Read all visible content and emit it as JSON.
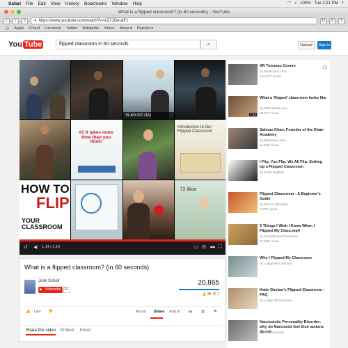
{
  "menubar": {
    "app": "Safari",
    "items": [
      "File",
      "Edit",
      "View",
      "History",
      "Bookmarks",
      "Window",
      "Help"
    ],
    "clock": "Tue 2:21 PM",
    "battery": "100%"
  },
  "window": {
    "title": "What is a flipped classroom? (in 60 seconds) - YouTube"
  },
  "toolbar": {
    "url": "https://www.youtube.com/watch?v=x2j7JGeukFc"
  },
  "bookmarks": [
    "Apple",
    "iCloud",
    "Facebook",
    "Twitter",
    "Wikipedia",
    "Yahoo",
    "News ▾",
    "Popular ▾"
  ],
  "youtube": {
    "logo_you": "You",
    "logo_tube": "Tube",
    "search_value": "flipped classroom in 60 seconds",
    "upload_label": "Upload",
    "signin_label": "Sign in"
  },
  "player": {
    "playlist_label": "PLAYLIST (16)",
    "time": "1:14 / 1:14",
    "progress": 1.0,
    "tiles": {
      "t6": "#1 It takes more time than you think!",
      "t8": "Introduction to Our Flipped Classroom",
      "t9a": "HOW TO",
      "t9b": "FLIP",
      "t9c": "YOUR CLASSROOM",
      "t12": "72 illion"
    }
  },
  "video": {
    "title": "What is a flipped classroom? (in 60 seconds)",
    "channel": "Julie Schell",
    "subscribe_label": "Subscribe",
    "sub_count": "23",
    "views": "20,865",
    "likes": "28",
    "dislikes": "1",
    "like_label": "Like",
    "actions": [
      "About",
      "Share",
      "Add to"
    ],
    "tabs": [
      "Share this video",
      "Embed",
      "Email"
    ]
  },
  "sidebar": [
    {
      "title": "XR Tonneau Covers",
      "channel": "by RealTruck.com",
      "views": "121,227 views",
      "duration": "",
      "colors": [
        "#5b5b5b",
        "#999999"
      ]
    },
    {
      "title": "What a 'flipped' classroom looks like",
      "channel": "by PBS NewsHour",
      "views": "29,271 views",
      "duration": "7:42",
      "colors": [
        "#6b4e3a",
        "#c9a47a"
      ]
    },
    {
      "title": "Salman Khan, Founder of the Khan Academy",
      "channel": "by Berkeley-Haas",
      "views": "11,509 views",
      "duration": "",
      "colors": [
        "#9b8577",
        "#3a3a3a"
      ]
    },
    {
      "title": "I Flip, You Flip, We All Flip: Setting Up a Flipped Classroom",
      "channel": "by Keith Hughes",
      "views": "",
      "duration": "",
      "colors": [
        "#ffffff",
        "#222222"
      ]
    },
    {
      "title": "Flipped Classroom - A Beginner's Guide",
      "channel": "by IPACA Sprocklin",
      "views": "6,073 views",
      "duration": "",
      "colors": [
        "#c65a2a",
        "#f2c078"
      ]
    },
    {
      "title": "5 Things I Wish I Knew When I Flipped My Class.mp4",
      "channel": "by GoEdDoctorsTeachers",
      "views": "17,586 views",
      "duration": "",
      "colors": [
        "#caa25f",
        "#8d6a3a"
      ]
    },
    {
      "title": "Why I Flipped My Classroom",
      "channel": "by Lodge McCammon",
      "views": "",
      "duration": "",
      "colors": [
        "#7a8c8f",
        "#c7d6d8"
      ]
    },
    {
      "title": "Katie Gimbar's Flipped Classroom - FAQ",
      "channel": "by Lodge McCammon",
      "views": "",
      "duration": "",
      "colors": [
        "#b08e6a",
        "#e6d6c3"
      ]
    },
    {
      "title": "Narcissistic Personality Disorder: why do Narcissist feel their actions do not",
      "channel": "by NPDrecovery",
      "views": "",
      "duration": "",
      "colors": [
        "#6b6b6b",
        "#bcbcbc"
      ]
    }
  ],
  "colors": {
    "accent": "#e62117",
    "blue": "#167ac6"
  }
}
